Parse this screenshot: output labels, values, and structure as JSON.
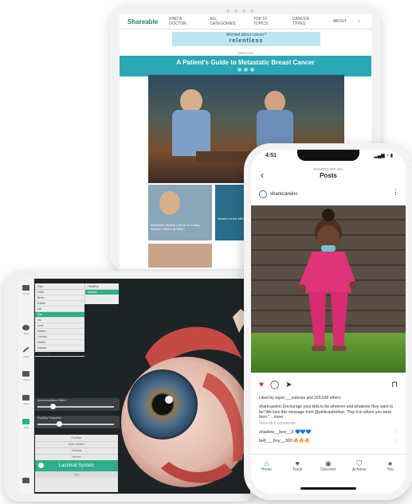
{
  "tablet_back": {
    "site_logo": "Shareable",
    "nav": [
      "FIND A DOCTOR",
      "ALL CATEGORIES",
      "TOP 10 TOPICS",
      "CANCER TYPES",
      "ABOUT"
    ],
    "ad_line1": "Worried about cancer?",
    "ad_line2": "relentless",
    "small_label": "Watch Now",
    "headline": "A Patient's Guide to Metastatic Breast Cancer",
    "thumb1_caption": "Metastatic Breast Cancer in Young Women: Who's at Risk?",
    "thumb2_caption": "Women in the MBC..."
  },
  "eye_app": {
    "sidebar": [
      "Home",
      "Tools",
      "Draw",
      "Layers",
      "Menu",
      "Hide"
    ],
    "list_header": "Eye",
    "list_items": [
      "Orbit",
      "Brow",
      "Eyelid",
      "Lid",
      "Eye",
      "Iris",
      "Lens",
      "Retina",
      "Cornea",
      "Sclera",
      "Lashes",
      "Eyelashes"
    ],
    "list_selected_index": 4,
    "sub_header": "Healthy",
    "sub_selected": "Healthy",
    "slider1_label": "Accommodation Reflex",
    "slider1_value": 0.2,
    "slider2_label": "Pupillary Response",
    "slider2_value": 0.28,
    "menu_header": "Further",
    "menu_options": [
      "Optic System",
      "Orbitalis",
      "Nerves"
    ],
    "menu_active": "Lacrimal System",
    "menu_footer": "Eye"
  },
  "phone": {
    "time": "4:51",
    "status": "▂▄▆ ◔ ▮",
    "account_sub": "SHARECARE INC",
    "screen_title": "Posts",
    "username": "sharecareinc",
    "liked_by": "Liked by super___sutesse and 169,939 others",
    "caption": "sharecareinc Encourage your kids to be whoever and whatever they want to be! We love this message from @pinkvaultvirtue. \"Pay it to where you were born.\" ...more",
    "view_comments": "View all 6 comments",
    "comment1": "shadow__bee__3 💙💙💙",
    "comment2": "bell___boy__300 🔥🔥🔥",
    "tabs": [
      {
        "label": "Home",
        "icon": "⌂"
      },
      {
        "label": "Track",
        "icon": "♥"
      },
      {
        "label": "Discover",
        "icon": "◉"
      },
      {
        "label": "Achieve",
        "icon": "⛉"
      },
      {
        "label": "You",
        "icon": "●"
      }
    ],
    "active_tab": "Home",
    "accent": "#1a73b8"
  }
}
